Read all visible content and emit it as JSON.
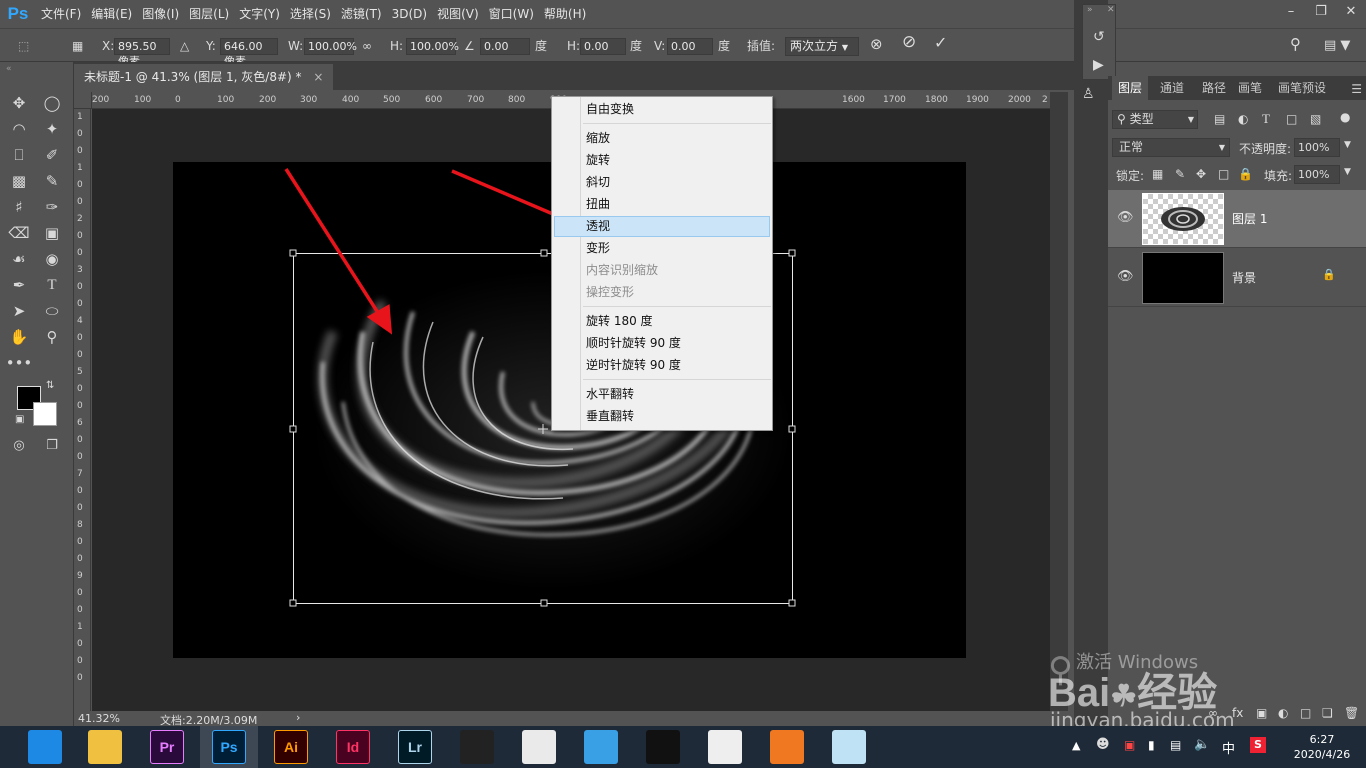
{
  "app": {
    "logo": "Ps"
  },
  "menubar": {
    "items": [
      "文件(F)",
      "编辑(E)",
      "图像(I)",
      "图层(L)",
      "文字(Y)",
      "选择(S)",
      "滤镜(T)",
      "3D(D)",
      "视图(V)",
      "窗口(W)",
      "帮助(H)"
    ]
  },
  "options": {
    "x_label": "X:",
    "x_value": "895.50 像素",
    "delta_icon": "triangle-icon",
    "y_label": "Y:",
    "y_value": "646.00 像素",
    "w_label": "W:",
    "w_value": "100.00%",
    "h_label": "H:",
    "h_value": "100.00%",
    "angle_value": "0.00",
    "angle_unit": "度",
    "hskew_label": "H:",
    "hskew_value": "0.00",
    "hskew_unit": "度",
    "vskew_label": "V:",
    "vskew_value": "0.00",
    "vskew_unit": "度",
    "interp_label": "插值:",
    "interp_value": "两次立方"
  },
  "document": {
    "tab_title": "未标题-1 @ 41.3% (图层 1, 灰色/8#) *",
    "close": "×"
  },
  "ruler": {
    "top_ticks": [
      "200",
      "100",
      "0",
      "100",
      "200",
      "300",
      "400",
      "500",
      "600",
      "700",
      "800",
      "900",
      "1600",
      "1700",
      "1800",
      "1900",
      "2000",
      "2"
    ],
    "left_ticks": [
      "1",
      "0",
      "0",
      "1",
      "0",
      "0",
      "2",
      "0",
      "0",
      "3",
      "0",
      "0",
      "4",
      "0",
      "0",
      "5",
      "0",
      "0",
      "6",
      "0",
      "0",
      "7",
      "0",
      "0",
      "8",
      "0",
      "0",
      "9",
      "0",
      "0",
      "1",
      "0",
      "0",
      "0"
    ]
  },
  "status": {
    "zoom": "41.32%",
    "doc": "文档:2.20M/3.09M",
    "arrow": "›"
  },
  "context_menu": {
    "items": [
      {
        "label": "自由变换",
        "state": "normal"
      },
      {
        "label": "缩放",
        "state": "normal"
      },
      {
        "label": "旋转",
        "state": "normal"
      },
      {
        "label": "斜切",
        "state": "normal"
      },
      {
        "label": "扭曲",
        "state": "normal"
      },
      {
        "label": "透视",
        "state": "highlighted"
      },
      {
        "label": "变形",
        "state": "normal"
      },
      {
        "label": "内容识别缩放",
        "state": "disabled"
      },
      {
        "label": "操控变形",
        "state": "disabled"
      },
      {
        "label": "旋转 180 度",
        "state": "normal"
      },
      {
        "label": "顺时针旋转 90 度",
        "state": "normal"
      },
      {
        "label": "逆时针旋转 90 度",
        "state": "normal"
      },
      {
        "label": "水平翻转",
        "state": "normal"
      },
      {
        "label": "垂直翻转",
        "state": "normal"
      }
    ]
  },
  "layers_panel": {
    "tabs": [
      "图层",
      "通道",
      "路径",
      "画笔",
      "画笔预设"
    ],
    "filter_value": "类型",
    "blend_mode": "正常",
    "opacity_label": "不透明度:",
    "opacity_value": "100%",
    "lock_label": "锁定:",
    "fill_label": "填充:",
    "fill_value": "100%",
    "layers": [
      {
        "name": "图层 1",
        "selected": true
      },
      {
        "name": "背景",
        "selected": false,
        "locked": true
      }
    ]
  },
  "watermark": {
    "line1": "激活 Windows",
    "brand": "Bai",
    "brand2": "经验",
    "url": "jingyan.baidu.com"
  },
  "taskbar": {
    "apps": [
      {
        "label": "",
        "icon": "browser-icon",
        "color": "#1e88e5"
      },
      {
        "label": "",
        "icon": "file-explorer-icon",
        "color": "#f0c040"
      },
      {
        "label": "Pr",
        "icon": "premiere-icon",
        "color": "#2a0a3a",
        "fg": "#e77cff"
      },
      {
        "label": "Ps",
        "icon": "photoshop-icon",
        "color": "#001e36",
        "fg": "#31a8ff"
      },
      {
        "label": "Ai",
        "icon": "illustrator-icon",
        "color": "#330000",
        "fg": "#ff9a00"
      },
      {
        "label": "Id",
        "icon": "indesign-icon",
        "color": "#49021f",
        "fg": "#ff3366"
      },
      {
        "label": "Lr",
        "icon": "lightroom-icon",
        "color": "#001a26",
        "fg": "#add5ec"
      },
      {
        "label": "",
        "icon": "video-editor-icon",
        "color": "#222"
      },
      {
        "label": "",
        "icon": "media-icon",
        "color": "#eaeaea"
      },
      {
        "label": "",
        "icon": "chat-app-icon",
        "color": "#39a0e6"
      },
      {
        "label": "",
        "icon": "qq-icon",
        "color": "#111"
      },
      {
        "label": "",
        "icon": "chrome-icon",
        "color": "#eee"
      },
      {
        "label": "",
        "icon": "orange-app-icon",
        "color": "#f07820"
      },
      {
        "label": "",
        "icon": "notepad-icon",
        "color": "#bfe3f5"
      }
    ],
    "ime": "中",
    "time": "6:27",
    "date": "2020/4/26"
  }
}
